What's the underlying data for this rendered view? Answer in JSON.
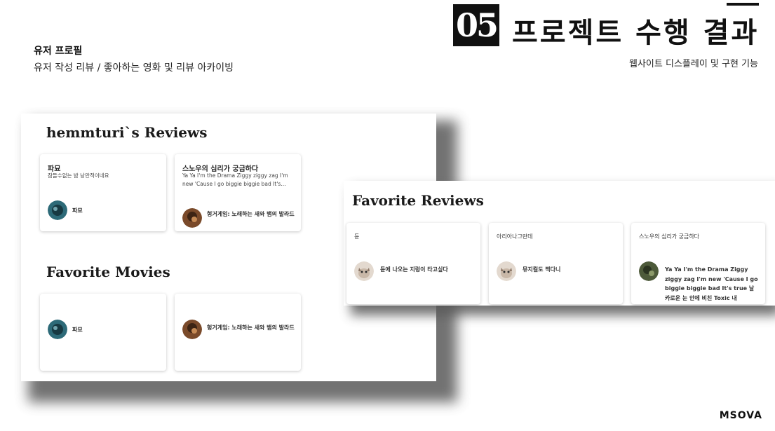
{
  "header": {
    "profile_title": "유저 프로필",
    "profile_desc": "유저 작성 리뷰 / 좋아하는 영화 및 리뷰 아카이빙",
    "section_number": "05",
    "section_title": "프로젝트 수행 결과",
    "section_subtitle": "웹사이트 디스플레이 및 구현 기능"
  },
  "reviews_section": {
    "title": "hemmturi`s Reviews",
    "cards": [
      {
        "title": "파묘",
        "snippet": "잠들수없는 밤 낭만적이네요",
        "movie": "파묘",
        "avatar_color": "#2d6a78"
      },
      {
        "title": "스노우의 심리가 궁금하다",
        "snippet": "Ya Ya I'm the Drama Ziggy ziggy zag I'm new 'Cause I go biggie biggie bad It's…",
        "movie": "헝거게임: 노래하는 새와 뱀의 발라드",
        "avatar_color": "#7a4a2a"
      }
    ]
  },
  "movies_section": {
    "title": "Favorite Movies",
    "cards": [
      {
        "movie": "파묘",
        "avatar_color": "#2d6a78"
      },
      {
        "movie": "헝거게임: 노래하는 새와 뱀의 발라드",
        "avatar_color": "#7a4a2a"
      }
    ]
  },
  "fav_reviews_section": {
    "title": "Favorite Reviews",
    "cards": [
      {
        "title": "듄",
        "text": "듄에 나오는 지렁이 타고싶다",
        "avatar_color": "#c9b8a8"
      },
      {
        "title": "아리아나그란데",
        "text": "뮤지컬도 찍다니",
        "avatar_color": "#c9b8a8"
      },
      {
        "title": "스노우의 심리가 궁금하다",
        "text": "Ya Ya I'm the Drama Ziggy ziggy zag I'm new 'Cause I go biggie biggie bad It's true 날카로운 눈 안에 비친 Toxic 내",
        "avatar_color": "#4d5a3a"
      }
    ]
  },
  "logo": "MSOVA"
}
